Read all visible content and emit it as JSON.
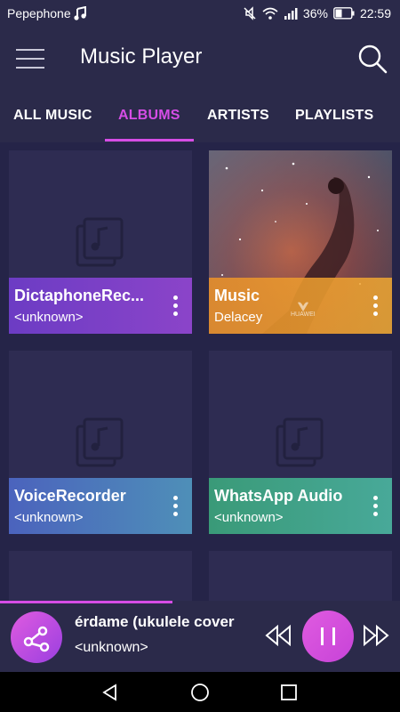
{
  "status_bar": {
    "carrier": "Pepephone",
    "battery": "36%",
    "time": "22:59",
    "icons": [
      "music-note-icon",
      "mute-icon",
      "wifi-icon",
      "signal-icon",
      "battery-icon"
    ]
  },
  "app_bar": {
    "title": "Music Player",
    "menu_icon": "hamburger-menu-icon",
    "search_icon": "search-icon"
  },
  "tabs": [
    {
      "label": "ALL MUSIC",
      "active": false
    },
    {
      "label": "ALBUMS",
      "active": true
    },
    {
      "label": "ARTISTS",
      "active": false
    },
    {
      "label": "PLAYLISTS",
      "active": false
    }
  ],
  "albums": [
    {
      "title": "DictaphoneRec...",
      "artist": "<unknown>",
      "has_artwork": false
    },
    {
      "title": "Music",
      "artist": "Delacey",
      "has_artwork": true,
      "artwork_badge": "HUAWEI"
    },
    {
      "title": "VoiceRecorder",
      "artist": "<unknown>",
      "has_artwork": false
    },
    {
      "title": "WhatsApp Audio",
      "artist": "<unknown>",
      "has_artwork": false
    }
  ],
  "now_playing": {
    "title": "érdame (ukulele cover",
    "artist": "<unknown>",
    "progress": 0.43
  },
  "colors": {
    "background": "#262448",
    "accent": "#d64de6",
    "footer_dictaphone": "#7b3fc8",
    "footer_music": "#e9902a",
    "footer_voice": "#4e7ac0",
    "footer_whatsapp": "#3a9f82"
  }
}
